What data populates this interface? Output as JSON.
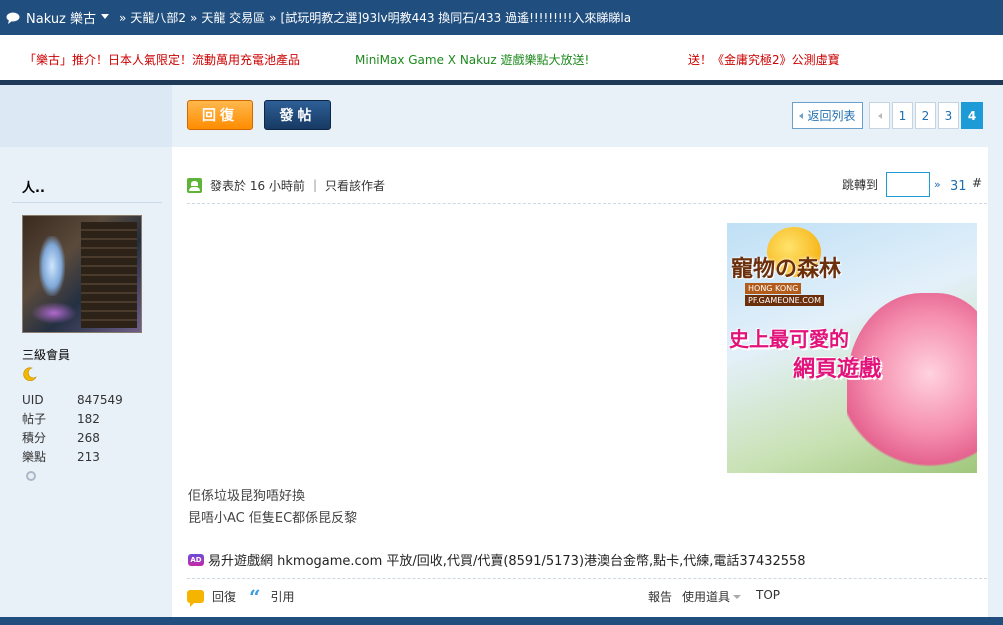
{
  "breadcrumb": {
    "site": "Nakuz 樂古",
    "sep": "»",
    "items": [
      "天龍八部2",
      "天龍 交易區",
      "[試玩明教之選]93lv明教443 換同石/433 過遙!!!!!!!!!入來睇睇la"
    ]
  },
  "ads": [
    {
      "label": "「樂古」推介！日本人氣限定！流動萬用充電池產品"
    },
    {
      "label": "MiniMax Game X Nakuz 遊戲樂點大放送!"
    },
    {
      "label": "送！《金庸究極2》公測虛寶"
    }
  ],
  "actions": {
    "reply_label": "回復",
    "post_label": "發帖"
  },
  "pagination": {
    "back_label": "返回列表",
    "pages": [
      "1",
      "2",
      "3"
    ],
    "current": "4"
  },
  "author": {
    "name": "人..",
    "rank": "三級會員",
    "stats": [
      {
        "key": "UID",
        "value": "847549"
      },
      {
        "key": "帖子",
        "value": "182"
      },
      {
        "key": "積分",
        "value": "268"
      },
      {
        "key": "樂點",
        "value": "213"
      }
    ]
  },
  "post": {
    "posted_label": "發表於",
    "posted_time": "16 小時前",
    "divider": "|",
    "only_author": "只看該作者",
    "jump_label": "跳轉到",
    "jump_go": "»",
    "floor": "31",
    "floor_hash": "#",
    "lines": [
      "佢係垃圾昆狗唔好換",
      "昆唔小AC 佢隻EC都係昆反黎"
    ],
    "sponsor_badge": "AD",
    "sponsor_text": "易升遊戲網 hkmogame.com 平放/回收,代買/代賣(8591/5173)港澳台金幣,點卡,代練,電話37432558"
  },
  "ad_image": {
    "title": "寵物の森林",
    "sub1": "HONG KONG",
    "sub2": "PF.GAMEONE.COM",
    "slogan1": "史上最可愛的",
    "slogan2": "網頁遊戲"
  },
  "footer": {
    "reply": "回復",
    "quote_mark": "“",
    "quote": "引用",
    "report": "報告",
    "tools": "使用道具",
    "top": "TOP"
  },
  "colors": {
    "topbar": "#1f4e7f",
    "accent_blue": "#1d9bd6",
    "reply_orange": "#ff8c00",
    "ad_red": "#cc0000",
    "ad_green": "#1e8a1e"
  }
}
